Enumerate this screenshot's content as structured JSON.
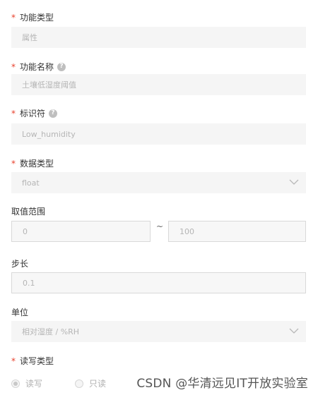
{
  "form": {
    "function_type": {
      "label": "功能类型",
      "value": "属性"
    },
    "function_name": {
      "label": "功能名称",
      "value": "土壤低湿度阈值"
    },
    "identifier": {
      "label": "标识符",
      "value": "Low_humidity"
    },
    "data_type": {
      "label": "数据类型",
      "value": "float"
    },
    "value_range": {
      "label": "取值范围",
      "min": "0",
      "separator": "~",
      "max": "100"
    },
    "step": {
      "label": "步长",
      "value": "0.1"
    },
    "unit": {
      "label": "单位",
      "value": "相对湿度 / %RH"
    },
    "rw_type": {
      "label": "读写类型",
      "options": [
        {
          "label": "读写",
          "selected": true
        },
        {
          "label": "只读",
          "selected": false
        }
      ]
    }
  },
  "required_mark": "*",
  "help_glyph": "?",
  "watermark": "CSDN @华清远见IT开放实验室",
  "colors": {
    "required": "#e8412c",
    "input_bg": "#f5f5f5",
    "placeholder_text": "#b5b5b5"
  }
}
